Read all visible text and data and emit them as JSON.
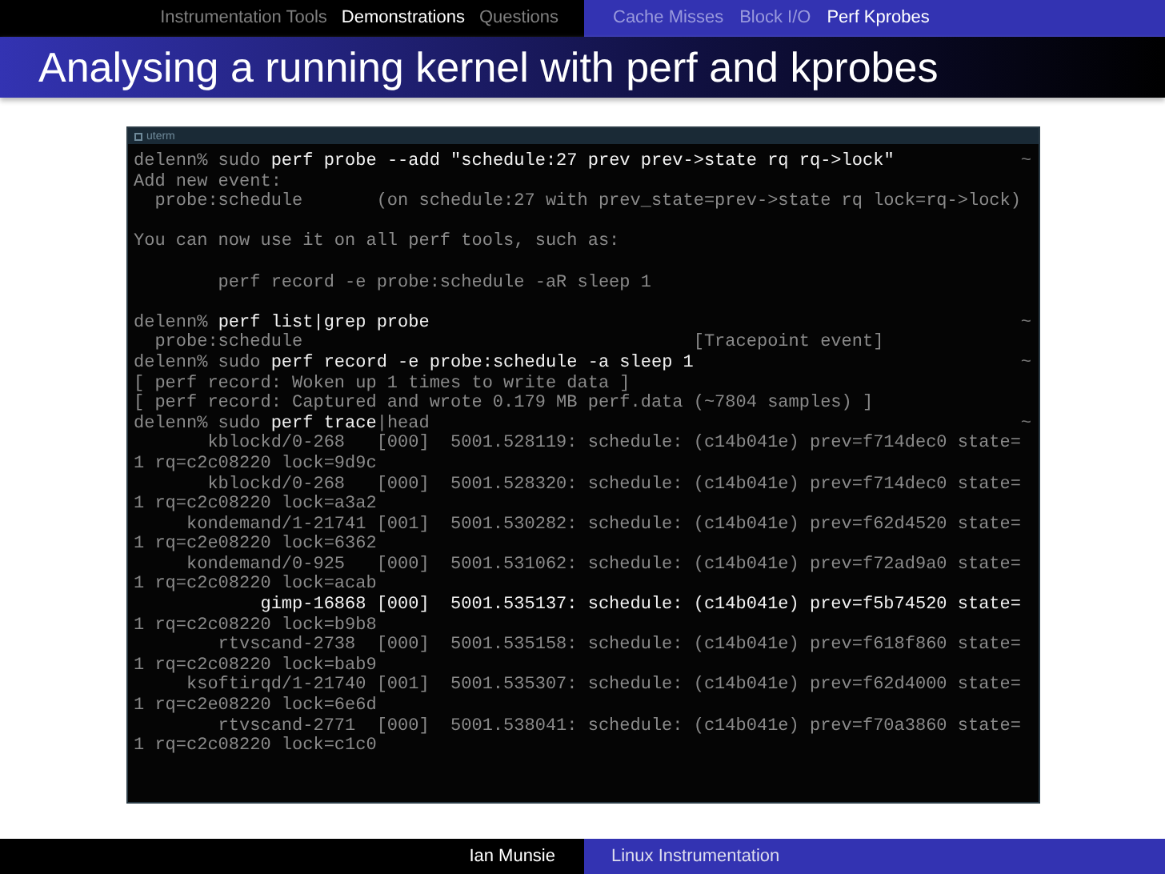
{
  "sections": [
    {
      "label": "Instrumentation Tools",
      "selected": false
    },
    {
      "label": "Demonstrations",
      "selected": true
    },
    {
      "label": "Questions",
      "selected": false
    }
  ],
  "subsections": [
    {
      "label": "Cache Misses",
      "selected": false
    },
    {
      "label": "Block I/O",
      "selected": false
    },
    {
      "label": "Perf Kprobes",
      "selected": true
    }
  ],
  "title": "Analysing a running kernel with perf and kprobes",
  "terminal": {
    "title": "uterm",
    "lines": [
      {
        "kind": "text",
        "segments": [
          {
            "text": "delenn% sudo ",
            "bright": false
          },
          {
            "text": "perf probe --add \"schedule:27 prev prev->state rq rq->lock\"",
            "bright": true
          }
        ],
        "right": "~"
      },
      {
        "kind": "text",
        "segments": [
          {
            "text": "Add new event:",
            "bright": false
          }
        ]
      },
      {
        "kind": "text",
        "segments": [
          {
            "text": "  probe:schedule       (on schedule:27 with prev_state=prev->state rq lock=rq->lock)",
            "bright": false
          }
        ]
      },
      {
        "kind": "blank"
      },
      {
        "kind": "text",
        "segments": [
          {
            "text": "You can now use it on all perf tools, such as:",
            "bright": false
          }
        ]
      },
      {
        "kind": "blank"
      },
      {
        "kind": "text",
        "segments": [
          {
            "text": "        perf record -e probe:schedule -aR sleep 1",
            "bright": false
          }
        ]
      },
      {
        "kind": "blank"
      },
      {
        "kind": "text",
        "segments": [
          {
            "text": "delenn% ",
            "bright": false
          },
          {
            "text": "perf list|grep probe",
            "bright": true
          }
        ],
        "right": "~"
      },
      {
        "kind": "text",
        "segments": [
          {
            "text": "  probe:schedule                                     [Tracepoint event]",
            "bright": false
          }
        ]
      },
      {
        "kind": "text",
        "segments": [
          {
            "text": "delenn% sudo ",
            "bright": false
          },
          {
            "text": "perf record -e probe:schedule -a sleep 1",
            "bright": true
          }
        ],
        "right": "~"
      },
      {
        "kind": "text",
        "segments": [
          {
            "text": "[ perf record: Woken up 1 times to write data ]",
            "bright": false
          }
        ]
      },
      {
        "kind": "text",
        "segments": [
          {
            "text": "[ perf record: Captured and wrote 0.179 MB perf.data (~7804 samples) ]",
            "bright": false
          }
        ]
      },
      {
        "kind": "text",
        "segments": [
          {
            "text": "delenn% sudo ",
            "bright": false
          },
          {
            "text": "perf trace",
            "bright": true
          },
          {
            "text": "|head",
            "bright": false
          }
        ],
        "right": "~"
      },
      {
        "kind": "text",
        "segments": [
          {
            "text": "       kblockd/0-268   [000]  5001.528119: schedule: (c14b041e) prev=f714dec0 state=",
            "bright": false
          }
        ]
      },
      {
        "kind": "text",
        "segments": [
          {
            "text": "1 rq=c2c08220 lock=9d9c",
            "bright": false
          }
        ]
      },
      {
        "kind": "text",
        "segments": [
          {
            "text": "       kblockd/0-268   [000]  5001.528320: schedule: (c14b041e) prev=f714dec0 state=",
            "bright": false
          }
        ]
      },
      {
        "kind": "text",
        "segments": [
          {
            "text": "1 rq=c2c08220 lock=a3a2",
            "bright": false
          }
        ]
      },
      {
        "kind": "text",
        "segments": [
          {
            "text": "     kondemand/1-21741 [001]  5001.530282: schedule: (c14b041e) prev=f62d4520 state=",
            "bright": false
          }
        ]
      },
      {
        "kind": "text",
        "segments": [
          {
            "text": "1 rq=c2e08220 lock=6362",
            "bright": false
          }
        ]
      },
      {
        "kind": "text",
        "segments": [
          {
            "text": "     kondemand/0-925   [000]  5001.531062: schedule: (c14b041e) prev=f72ad9a0 state=",
            "bright": false
          }
        ]
      },
      {
        "kind": "text",
        "segments": [
          {
            "text": "1 rq=c2c08220 lock=acab",
            "bright": false
          }
        ]
      },
      {
        "kind": "text",
        "segments": [
          {
            "text": "            gimp-16868 [000]  5001.535137: schedule: (c14b041e) prev=f5b74520 state=",
            "bright": true
          }
        ]
      },
      {
        "kind": "text",
        "segments": [
          {
            "text": "1 rq=c2c08220 lock=b9b8",
            "bright": false
          }
        ]
      },
      {
        "kind": "text",
        "segments": [
          {
            "text": "        rtvscand-2738  [000]  5001.535158: schedule: (c14b041e) prev=f618f860 state=",
            "bright": false
          }
        ]
      },
      {
        "kind": "text",
        "segments": [
          {
            "text": "1 rq=c2c08220 lock=bab9",
            "bright": false
          }
        ]
      },
      {
        "kind": "text",
        "segments": [
          {
            "text": "     ksoftirqd/1-21740 [001]  5001.535307: schedule: (c14b041e) prev=f62d4000 state=",
            "bright": false
          }
        ]
      },
      {
        "kind": "text",
        "segments": [
          {
            "text": "1 rq=c2e08220 lock=6e6d",
            "bright": false
          }
        ]
      },
      {
        "kind": "text",
        "segments": [
          {
            "text": "        rtvscand-2771  [000]  5001.538041: schedule: (c14b041e) prev=f70a3860 state=",
            "bright": false
          }
        ]
      },
      {
        "kind": "text",
        "segments": [
          {
            "text": "1 rq=c2c08220 lock=c1c0",
            "bright": false
          }
        ]
      }
    ]
  },
  "footer": {
    "author": "Ian Munsie",
    "talk": "Linux Instrumentation"
  }
}
